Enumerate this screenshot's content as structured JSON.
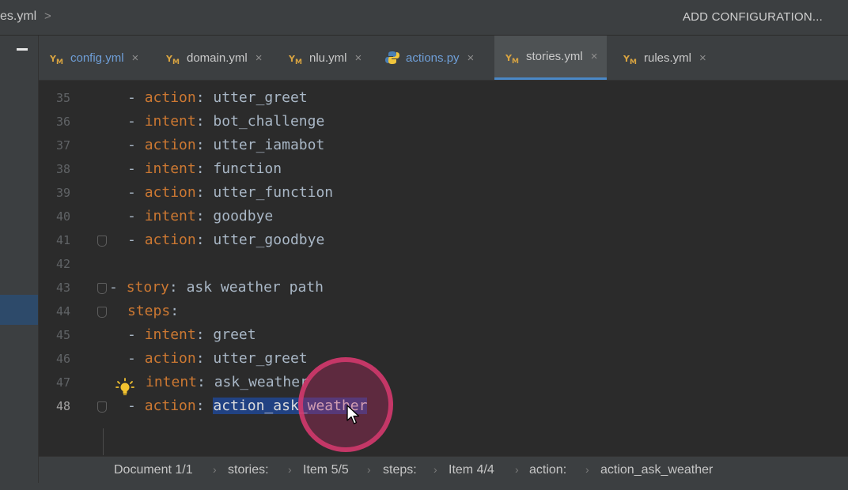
{
  "toolbar": {
    "breadcrumb_file": "es.yml",
    "breadcrumb_chevron": ">",
    "add_configuration": "ADD CONFIGURATION..."
  },
  "tabs": [
    {
      "label": "config.yml",
      "icon": "yaml-file-icon",
      "active": false
    },
    {
      "label": "domain.yml",
      "icon": "yaml-file-icon",
      "active": false
    },
    {
      "label": "nlu.yml",
      "icon": "yaml-file-icon",
      "active": false
    },
    {
      "label": "actions.py",
      "icon": "python-file-icon",
      "active": false
    },
    {
      "label": "stories.yml",
      "icon": "yaml-file-icon",
      "active": true
    },
    {
      "label": "rules.yml",
      "icon": "yaml-file-icon",
      "active": false
    }
  ],
  "tab_close": "×",
  "editor": {
    "lines": [
      {
        "num": "35",
        "dash": "- ",
        "key": "action",
        "sep": ": ",
        "value": "utter_greet"
      },
      {
        "num": "36",
        "dash": "- ",
        "key": "intent",
        "sep": ": ",
        "value": "bot_challenge"
      },
      {
        "num": "37",
        "dash": "- ",
        "key": "action",
        "sep": ": ",
        "value": "utter_iamabot"
      },
      {
        "num": "38",
        "dash": "- ",
        "key": "intent",
        "sep": ": ",
        "value": "function"
      },
      {
        "num": "39",
        "dash": "- ",
        "key": "action",
        "sep": ": ",
        "value": "utter_function"
      },
      {
        "num": "40",
        "dash": "- ",
        "key": "intent",
        "sep": ": ",
        "value": "goodbye"
      },
      {
        "num": "41",
        "dash": "- ",
        "key": "action",
        "sep": ": ",
        "value": "utter_goodbye"
      },
      {
        "num": "42",
        "dash": "",
        "key": "",
        "sep": "",
        "value": ""
      },
      {
        "num": "43",
        "dash": "- ",
        "key": "story",
        "sep": ": ",
        "value": "ask weather path"
      },
      {
        "num": "44",
        "dash": "",
        "key": "steps",
        "sep": ":",
        "value": ""
      },
      {
        "num": "45",
        "dash": "- ",
        "key": "intent",
        "sep": ": ",
        "value": "greet"
      },
      {
        "num": "46",
        "dash": "- ",
        "key": "action",
        "sep": ": ",
        "value": "utter_greet"
      },
      {
        "num": "47",
        "dash": "",
        "key": "intent",
        "sep": ": ",
        "value": "ask_weather"
      },
      {
        "num": "48",
        "dash": "- ",
        "key": "action",
        "sep": ": ",
        "value": "action_ask_weather"
      }
    ]
  },
  "breadcrumbs": [
    "Document 1/1",
    "stories:",
    "Item 5/5",
    "steps:",
    "Item 4/4",
    "action:",
    "action_ask_weather"
  ],
  "breadcrumb_separator": "›",
  "colors": {
    "keyword": "#cc7832",
    "text": "#a9b7c6",
    "selection": "#214283",
    "click_ring": "#d63a6e",
    "active_tab_underline": "#4a88c7"
  }
}
